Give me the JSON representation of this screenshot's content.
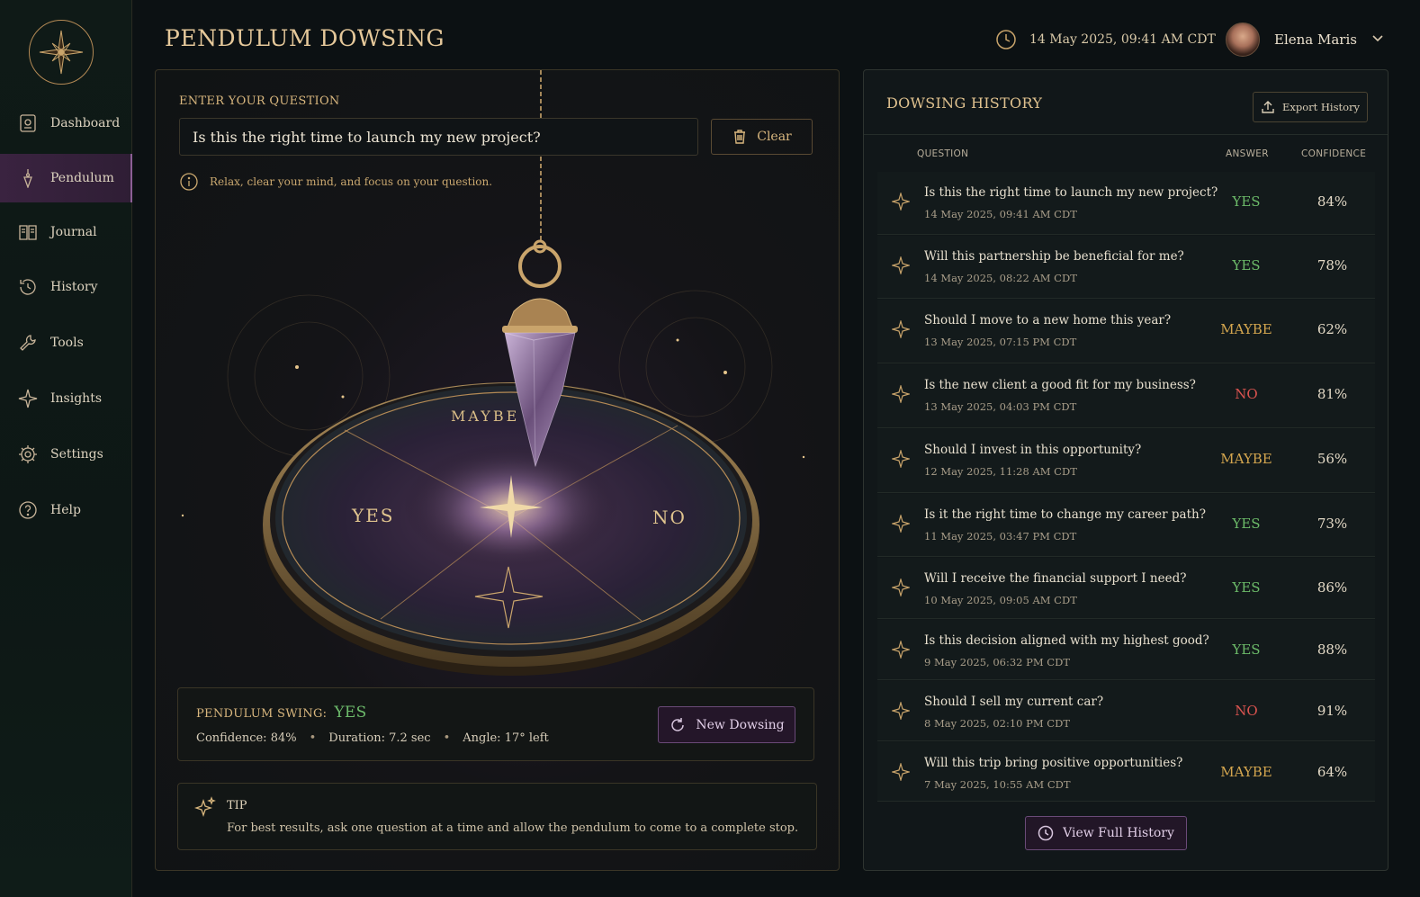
{
  "header": {
    "title": "PENDULUM DOWSING",
    "datetime": "14 May 2025, 09:41 AM CDT",
    "user_name": "Elena Maris"
  },
  "sidebar": {
    "items": [
      {
        "label": "Dashboard",
        "icon": "dashboard-icon"
      },
      {
        "label": "Pendulum",
        "icon": "pendulum-icon",
        "active": true
      },
      {
        "label": "Journal",
        "icon": "journal-icon"
      },
      {
        "label": "History",
        "icon": "history-icon"
      },
      {
        "label": "Tools",
        "icon": "tools-icon"
      },
      {
        "label": "Insights",
        "icon": "insights-icon"
      },
      {
        "label": "Settings",
        "icon": "settings-icon"
      },
      {
        "label": "Help",
        "icon": "help-icon"
      }
    ]
  },
  "question": {
    "label": "ENTER YOUR QUESTION",
    "value": "Is this the right time to launch my new project?",
    "clear_label": "Clear",
    "hint": "Relax, clear your mind, and focus on your question."
  },
  "board": {
    "yes": "YES",
    "no": "NO",
    "maybe": "MAYBE"
  },
  "result": {
    "label": "PENDULUM SWING:",
    "value": "YES",
    "confidence": "Confidence: 84%",
    "duration": "Duration: 7.2 sec",
    "angle": "Angle: 17° left",
    "new_label": "New Dowsing"
  },
  "tip": {
    "title": "TIP",
    "text": "For best results, ask one question at a time and allow the pendulum to come to a complete stop."
  },
  "history": {
    "title": "DOWSING HISTORY",
    "export_label": "Export History",
    "columns": {
      "question": "QUESTION",
      "answer": "ANSWER",
      "confidence": "CONFIDENCE"
    },
    "rows": [
      {
        "question": "Is this the right time to launch my new project?",
        "date": "14 May 2025, 09:41 AM CDT",
        "answer": "YES",
        "confidence": "84%"
      },
      {
        "question": "Will this partnership be beneficial for me?",
        "date": "14 May 2025, 08:22 AM CDT",
        "answer": "YES",
        "confidence": "78%"
      },
      {
        "question": "Should I move to a new home this year?",
        "date": "13 May 2025, 07:15 PM CDT",
        "answer": "MAYBE",
        "confidence": "62%"
      },
      {
        "question": "Is the new client a good fit for my business?",
        "date": "13 May 2025, 04:03 PM CDT",
        "answer": "NO",
        "confidence": "81%"
      },
      {
        "question": "Should I invest in this opportunity?",
        "date": "12 May 2025, 11:28 AM CDT",
        "answer": "MAYBE",
        "confidence": "56%"
      },
      {
        "question": "Is it the right time to change my career path?",
        "date": "11 May 2025, 03:47 PM CDT",
        "answer": "YES",
        "confidence": "73%"
      },
      {
        "question": "Will I receive the financial support I need?",
        "date": "10 May 2025, 09:05 AM CDT",
        "answer": "YES",
        "confidence": "86%"
      },
      {
        "question": "Is this decision aligned with my highest good?",
        "date": "9 May 2025, 06:32 PM CDT",
        "answer": "YES",
        "confidence": "88%"
      },
      {
        "question": "Should I sell my current car?",
        "date": "8 May 2025, 02:10 PM CDT",
        "answer": "NO",
        "confidence": "91%"
      },
      {
        "question": "Will this trip bring positive opportunities?",
        "date": "7 May 2025, 10:55 AM CDT",
        "answer": "MAYBE",
        "confidence": "64%"
      }
    ],
    "view_full_label": "View Full History"
  },
  "colors": {
    "accent_gold": "#d9b77e",
    "yes": "#6cbb69",
    "no": "#d9534f",
    "maybe": "#d4a64f",
    "purple": "#6a4a78"
  }
}
